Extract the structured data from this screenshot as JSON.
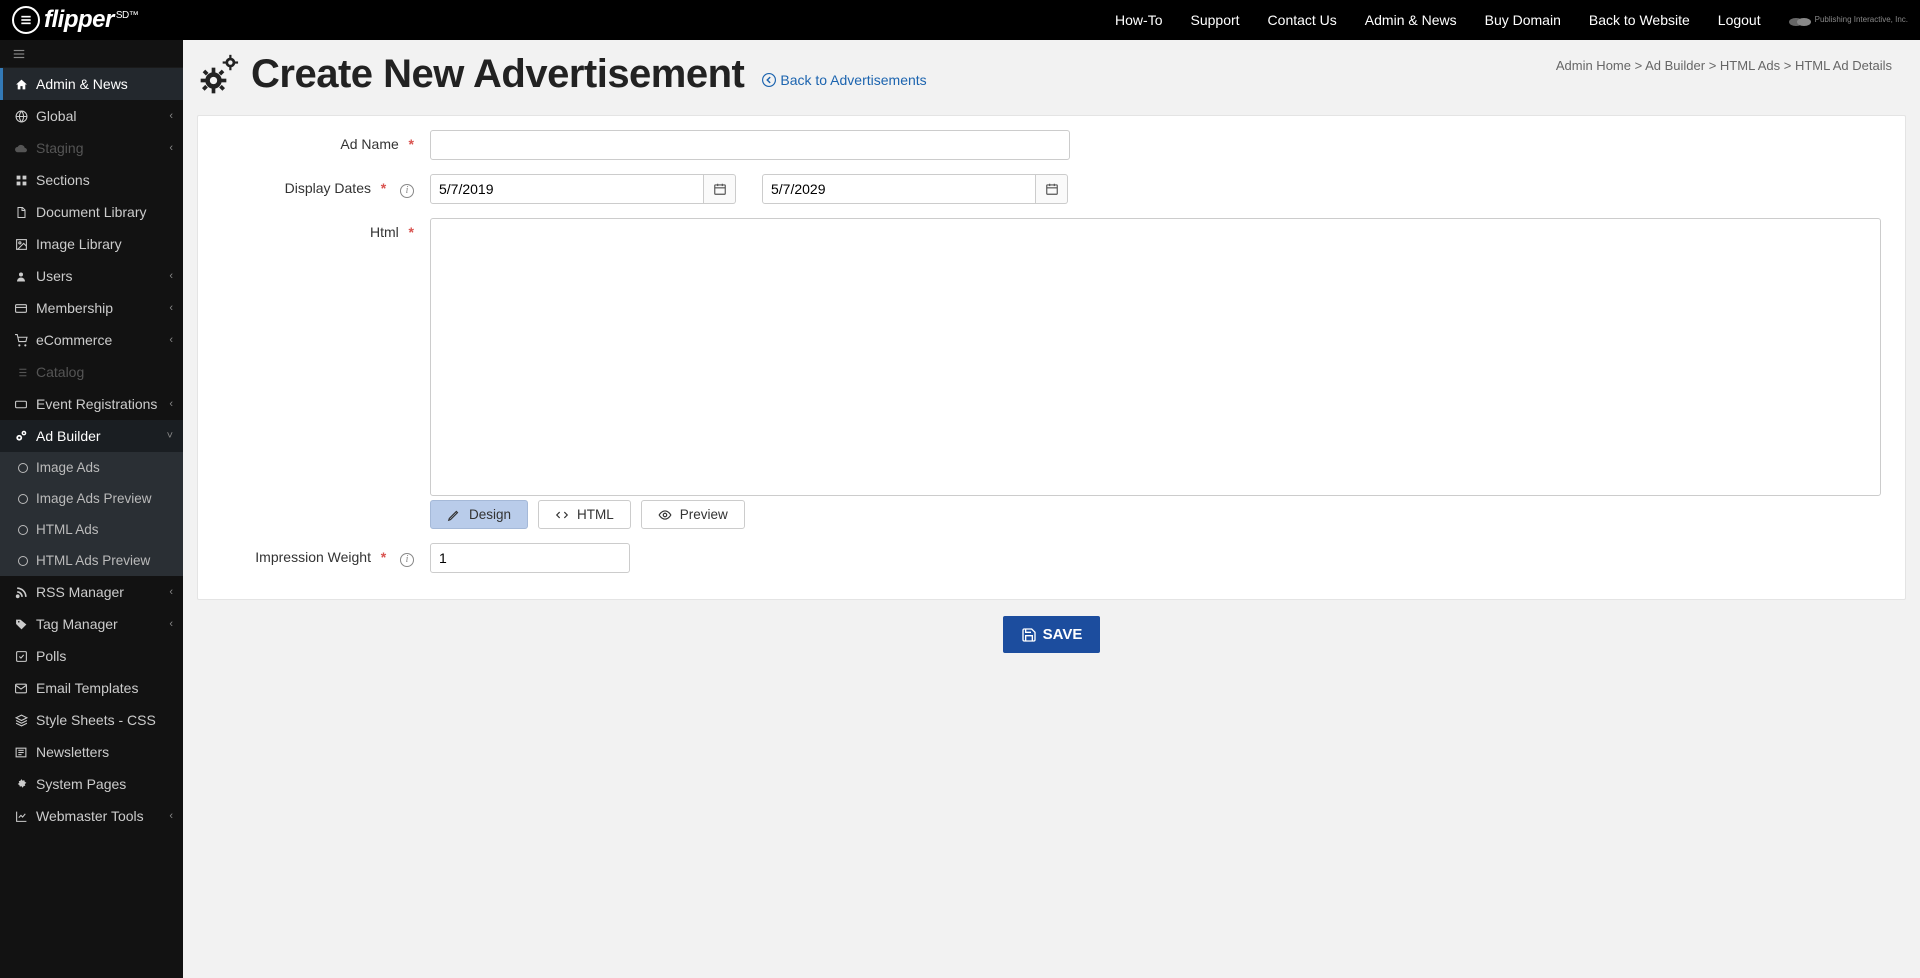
{
  "brand": {
    "name": "flipper",
    "suffix": "SD™"
  },
  "topnav": [
    "How-To",
    "Support",
    "Contact Us",
    "Admin & News",
    "Buy Domain",
    "Back to Website",
    "Logout"
  ],
  "publisher": "Publishing Interactive, Inc.",
  "sidebar": {
    "items": [
      {
        "icon": "home",
        "label": "Admin & News",
        "active": true
      },
      {
        "icon": "globe",
        "label": "Global",
        "chev": true
      },
      {
        "icon": "cloud",
        "label": "Staging",
        "chev": true,
        "disabled": true
      },
      {
        "icon": "sections",
        "label": "Sections"
      },
      {
        "icon": "doc",
        "label": "Document Library"
      },
      {
        "icon": "image",
        "label": "Image Library"
      },
      {
        "icon": "user",
        "label": "Users",
        "chev": true
      },
      {
        "icon": "card",
        "label": "Membership",
        "chev": true
      },
      {
        "icon": "cart",
        "label": "eCommerce",
        "chev": true
      },
      {
        "icon": "list",
        "label": "Catalog",
        "disabled": true
      },
      {
        "icon": "ticket",
        "label": "Event Registrations",
        "chev": true
      },
      {
        "icon": "gears",
        "label": "Ad Builder",
        "chev": true,
        "expanded": true,
        "children": [
          "Image Ads",
          "Image Ads Preview",
          "HTML Ads",
          "HTML Ads Preview"
        ]
      },
      {
        "icon": "rss",
        "label": "RSS Manager",
        "chev": true
      },
      {
        "icon": "tag",
        "label": "Tag Manager",
        "chev": true
      },
      {
        "icon": "check",
        "label": "Polls"
      },
      {
        "icon": "mail",
        "label": "Email Templates"
      },
      {
        "icon": "stack",
        "label": "Style Sheets - CSS"
      },
      {
        "icon": "news",
        "label": "Newsletters"
      },
      {
        "icon": "gear",
        "label": "System Pages"
      },
      {
        "icon": "chart",
        "label": "Webmaster Tools",
        "chev": true
      }
    ]
  },
  "page": {
    "title": "Create New Advertisement",
    "back": "Back to Advertisements",
    "breadcrumbs": [
      "Admin Home",
      "Ad Builder",
      "HTML Ads",
      "HTML Ad Details"
    ]
  },
  "form": {
    "labels": {
      "ad_name": "Ad Name",
      "display_dates": "Display Dates",
      "html": "Html",
      "impression_weight": "Impression Weight"
    },
    "values": {
      "ad_name": "",
      "start_date": "5/7/2019",
      "end_date": "5/7/2029",
      "html": "",
      "impression_weight": "1"
    },
    "editor_tabs": {
      "design": "Design",
      "html": "HTML",
      "preview": "Preview"
    },
    "save": "SAVE"
  }
}
